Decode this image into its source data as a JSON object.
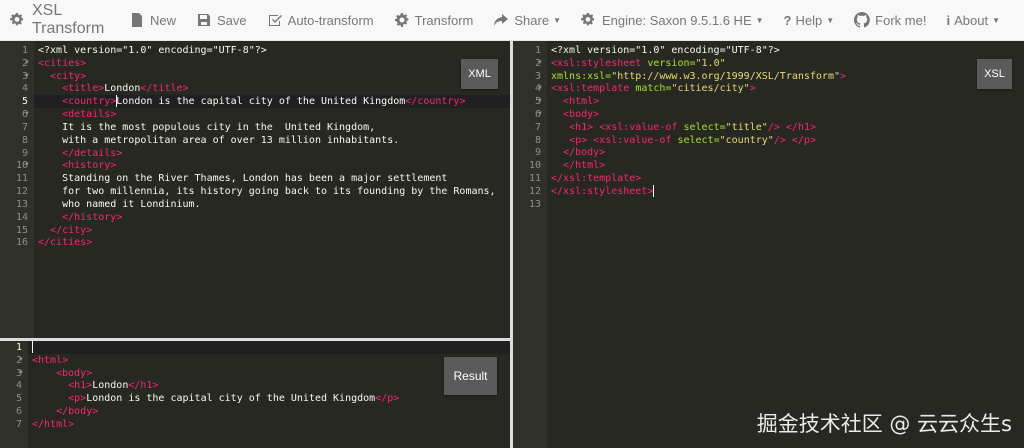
{
  "navbar": {
    "brand": "XSL Transform",
    "new_label": "New",
    "save_label": "Save",
    "auto_label": "Auto-transform",
    "transform_label": "Transform",
    "share_label": "Share",
    "engine_label": "Engine: Saxon 9.5.1.6 HE",
    "help_label": "Help",
    "fork_label": "Fork me!",
    "about_label": "About"
  },
  "xml_editor": {
    "button_label": "XML",
    "lines": [
      [
        [
          "pi",
          "<?xml version=\"1.0\" encoding=\"UTF-8\"?>"
        ]
      ],
      [
        [
          "tag",
          "<cities>"
        ]
      ],
      [
        [
          "txt",
          "  "
        ],
        [
          "tag",
          "<city>"
        ]
      ],
      [
        [
          "txt",
          "    "
        ],
        [
          "tag",
          "<title>"
        ],
        [
          "txt",
          "London"
        ],
        [
          "tag",
          "</title>"
        ]
      ],
      [
        [
          "txt",
          "    "
        ],
        [
          "tag",
          "<country>"
        ],
        [
          "cursor",
          ""
        ],
        [
          "txt",
          "London is the capital city of the United Kingdom"
        ],
        [
          "tag",
          "</country>"
        ]
      ],
      [
        [
          "txt",
          "    "
        ],
        [
          "tag",
          "<details>"
        ]
      ],
      [
        [
          "txt",
          "    It is the most populous city in the  United Kingdom,"
        ]
      ],
      [
        [
          "txt",
          "    with a metropolitan area of over 13 million inhabitants."
        ]
      ],
      [
        [
          "txt",
          "    "
        ],
        [
          "tag",
          "</details>"
        ]
      ],
      [
        [
          "txt",
          "    "
        ],
        [
          "tag",
          "<history>"
        ]
      ],
      [
        [
          "txt",
          "    Standing on the River Thames, London has been a major settlement"
        ]
      ],
      [
        [
          "txt",
          "    for two millennia, its history going back to its founding by the Romans,"
        ]
      ],
      [
        [
          "txt",
          "    who named it Londinium."
        ]
      ],
      [
        [
          "txt",
          "    "
        ],
        [
          "tag",
          "</history>"
        ]
      ],
      [
        [
          "txt",
          "  "
        ],
        [
          "tag",
          "</city>"
        ]
      ],
      [
        [
          "tag",
          "</cities>"
        ]
      ]
    ],
    "active_line": 5,
    "fold_lines": [
      2,
      3,
      6,
      10
    ]
  },
  "xsl_editor": {
    "button_label": "XSL",
    "lines": [
      [
        [
          "pi",
          "<?xml version=\"1.0\" encoding=\"UTF-8\"?>"
        ]
      ],
      [
        [
          "tag",
          "<xsl:stylesheet"
        ],
        [
          "txt",
          " "
        ],
        [
          "attr",
          "version="
        ],
        [
          "str",
          "\"1.0\""
        ]
      ],
      [
        [
          "attr",
          "xmlns:xsl="
        ],
        [
          "str",
          "\"http://www.w3.org/1999/XSL/Transform\""
        ],
        [
          "tag",
          ">"
        ]
      ],
      [
        [
          "tag",
          "<xsl:template"
        ],
        [
          "txt",
          " "
        ],
        [
          "attr",
          "match="
        ],
        [
          "str",
          "\"cities/city\""
        ],
        [
          "tag",
          ">"
        ]
      ],
      [
        [
          "txt",
          "  "
        ],
        [
          "tag",
          "<html>"
        ]
      ],
      [
        [
          "txt",
          "  "
        ],
        [
          "tag",
          "<body>"
        ]
      ],
      [
        [
          "txt",
          "   "
        ],
        [
          "tag",
          "<h1>"
        ],
        [
          "txt",
          " "
        ],
        [
          "tag",
          "<xsl:value-of"
        ],
        [
          "txt",
          " "
        ],
        [
          "attr",
          "select="
        ],
        [
          "str",
          "\"title\""
        ],
        [
          "tag",
          "/>"
        ],
        [
          "txt",
          " "
        ],
        [
          "tag",
          "</h1>"
        ]
      ],
      [
        [
          "txt",
          "   "
        ],
        [
          "tag",
          "<p>"
        ],
        [
          "txt",
          " "
        ],
        [
          "tag",
          "<xsl:value-of"
        ],
        [
          "txt",
          " "
        ],
        [
          "attr",
          "select="
        ],
        [
          "str",
          "\"country\""
        ],
        [
          "tag",
          "/>"
        ],
        [
          "txt",
          " "
        ],
        [
          "tag",
          "</p>"
        ]
      ],
      [
        [
          "txt",
          "  "
        ],
        [
          "tag",
          "</body>"
        ]
      ],
      [
        [
          "txt",
          "  "
        ],
        [
          "tag",
          "</html>"
        ]
      ],
      [
        [
          "tag",
          "</xsl:template>"
        ]
      ],
      [
        [
          "tag",
          "</xsl:stylesheet>"
        ],
        [
          "cursor",
          ""
        ]
      ],
      []
    ],
    "active_line": 0,
    "fold_lines": [
      2,
      4,
      5,
      6
    ]
  },
  "result_editor": {
    "button_label": "Result",
    "lines": [
      [
        [
          "cursor",
          ""
        ]
      ],
      [
        [
          "tag",
          "<html>"
        ]
      ],
      [
        [
          "txt",
          "    "
        ],
        [
          "tag",
          "<body>"
        ]
      ],
      [
        [
          "txt",
          "      "
        ],
        [
          "tag",
          "<h1>"
        ],
        [
          "txt",
          "London"
        ],
        [
          "tag",
          "</h1>"
        ]
      ],
      [
        [
          "txt",
          "      "
        ],
        [
          "tag",
          "<p>"
        ],
        [
          "txt",
          "London is the capital city of the United Kingdom"
        ],
        [
          "tag",
          "</p>"
        ]
      ],
      [
        [
          "txt",
          "    "
        ],
        [
          "tag",
          "</body>"
        ]
      ],
      [
        [
          "tag",
          "</html>"
        ]
      ]
    ],
    "active_line": 1,
    "fold_lines": [
      2,
      3
    ]
  },
  "watermark": "掘金技术社区 @ 云云众生s",
  "colors": {
    "tag": "#f92672",
    "attr": "#a6e22e",
    "string": "#e6db74",
    "editor_bg": "#272822",
    "navbar_bg": "#f8f8f8"
  }
}
